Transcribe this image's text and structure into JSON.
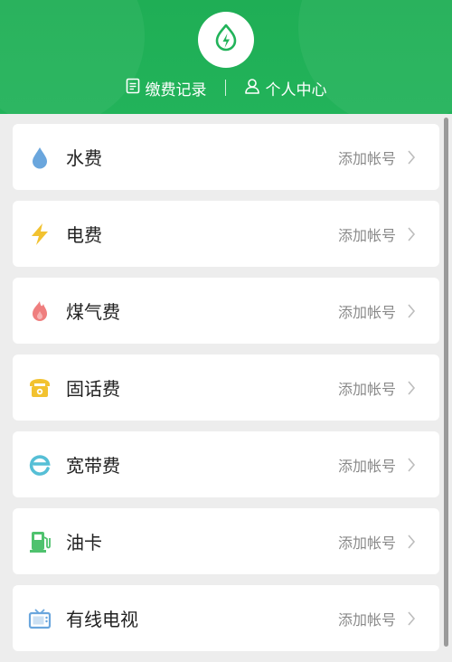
{
  "header": {
    "links": [
      {
        "label": "缴费记录",
        "icon": "receipt-icon"
      },
      {
        "label": "个人中心",
        "icon": "user-icon"
      }
    ],
    "logo_icon": "lightning-drop-logo-icon",
    "accent_color": "#22b35a"
  },
  "items": [
    {
      "label": "水费",
      "action": "添加帐号",
      "icon": "water-drop-icon",
      "color": "#6aa6dd"
    },
    {
      "label": "电费",
      "action": "添加帐号",
      "icon": "lightning-icon",
      "color": "#f2c230"
    },
    {
      "label": "煤气费",
      "action": "添加帐号",
      "icon": "flame-icon",
      "color": "#ef7e7e"
    },
    {
      "label": "固话费",
      "action": "添加帐号",
      "icon": "telephone-icon",
      "color": "#f2c230"
    },
    {
      "label": "宽带费",
      "action": "添加帐号",
      "icon": "internet-e-icon",
      "color": "#56bfd6"
    },
    {
      "label": "油卡",
      "action": "添加帐号",
      "icon": "fuel-pump-icon",
      "color": "#4fc26e"
    },
    {
      "label": "有线电视",
      "action": "添加帐号",
      "icon": "tv-icon",
      "color": "#6aa6dd"
    }
  ]
}
